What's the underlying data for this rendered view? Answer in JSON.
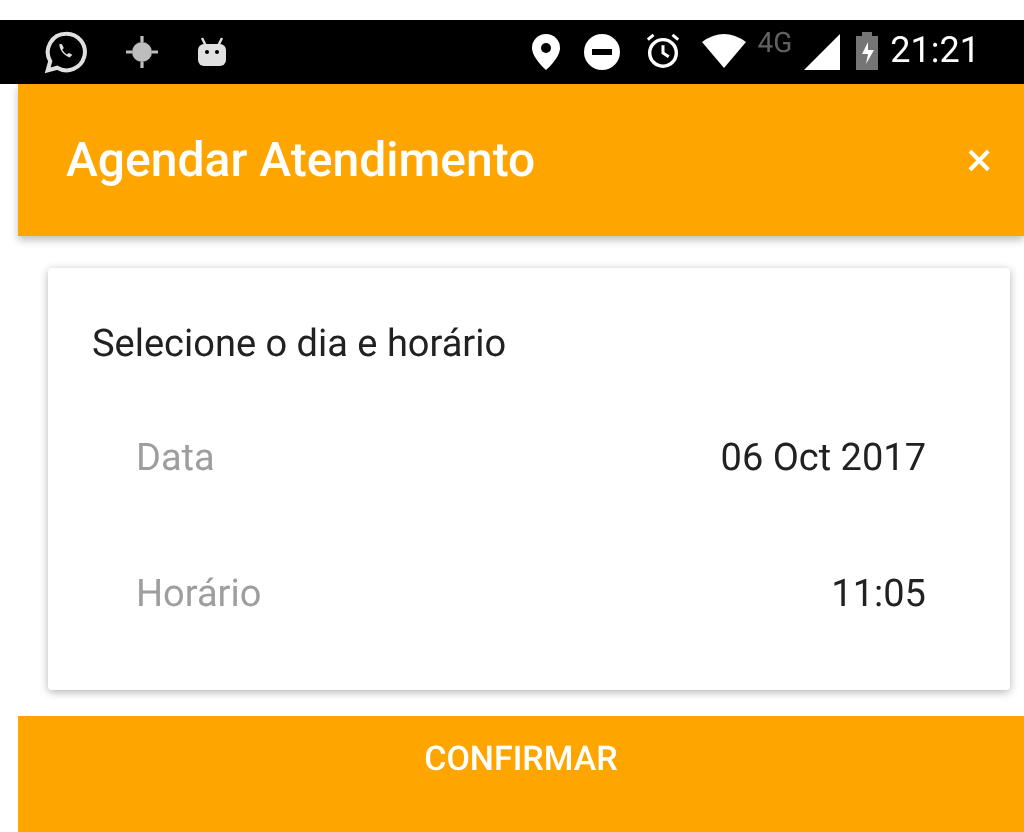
{
  "status_bar": {
    "network": "4G",
    "time": "21:21"
  },
  "app_bar": {
    "title": "Agendar Atendimento",
    "close": "×"
  },
  "card": {
    "heading": "Selecione o dia e horário",
    "rows": [
      {
        "label": "Data",
        "value": "06 Oct 2017"
      },
      {
        "label": "Horário",
        "value": "11:05"
      }
    ]
  },
  "confirm_button": "CONFIRMAR"
}
